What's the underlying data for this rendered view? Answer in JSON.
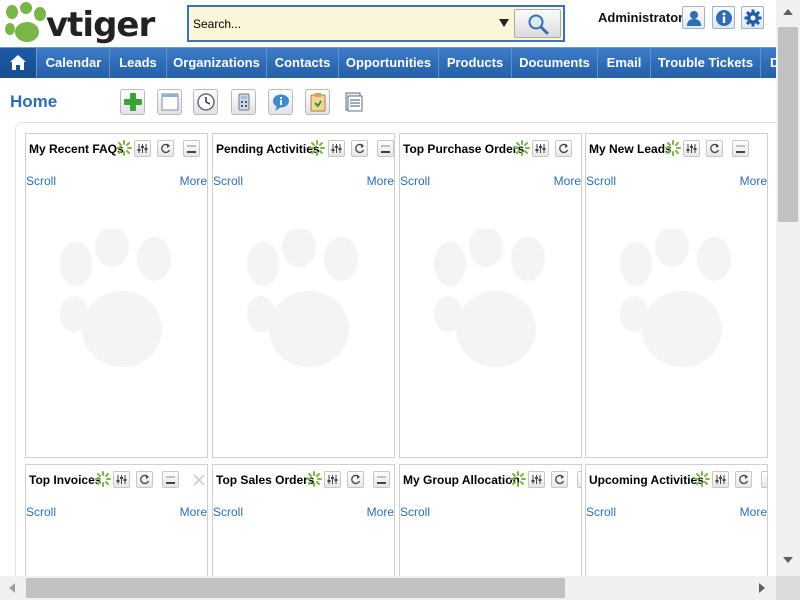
{
  "app": {
    "logo_text": "vtiger",
    "brand_green": "#7ab547",
    "accent_blue": "#2a6fb5"
  },
  "search": {
    "placeholder": "Search...",
    "value": ""
  },
  "header": {
    "user_label": "Administrator",
    "icons": [
      "user-profile-icon",
      "info-icon",
      "settings-gear-icon"
    ]
  },
  "nav": {
    "home_icon": "home-icon",
    "items": [
      {
        "label": "Calendar"
      },
      {
        "label": "Leads"
      },
      {
        "label": "Organizations"
      },
      {
        "label": "Contacts"
      },
      {
        "label": "Opportunities"
      },
      {
        "label": "Products"
      },
      {
        "label": "Documents"
      },
      {
        "label": "Email"
      },
      {
        "label": "Trouble Tickets"
      },
      {
        "label": "D"
      }
    ]
  },
  "page": {
    "title": "Home",
    "toolbar_icons": [
      "add-widget-icon",
      "layout-icon",
      "clock-icon",
      "calculator-icon",
      "chat-icon",
      "clipboard-icon",
      "notes-icon"
    ]
  },
  "widgets": [
    {
      "title": "My Recent FAQs",
      "scroll": "Scroll",
      "more": "More"
    },
    {
      "title": "Pending Activities",
      "scroll": "Scroll",
      "more": "More"
    },
    {
      "title": "Top Purchase Orders",
      "scroll": "Scroll",
      "more": "More"
    },
    {
      "title": "My New Leads",
      "scroll": "Scroll",
      "more": "More"
    },
    {
      "title": "Top Invoices",
      "scroll": "Scroll",
      "more": "More"
    },
    {
      "title": "Top Sales Orders",
      "scroll": "Scroll",
      "more": "More"
    },
    {
      "title": "My Group Allocation",
      "scroll": "Scroll",
      "more": ""
    },
    {
      "title": "Upcoming Activities",
      "scroll": "Scroll",
      "more": "More"
    }
  ]
}
